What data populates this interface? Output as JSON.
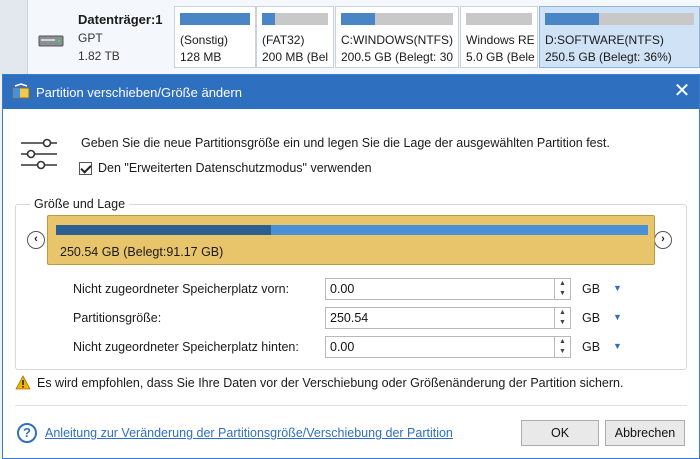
{
  "disk_map": {
    "disk_name": "Datenträger:1",
    "disk_type": "GPT",
    "disk_size": "1.82 TB",
    "partitions": [
      {
        "label": "(Sonstig)",
        "detail": "128 MB",
        "fill": 1.0
      },
      {
        "label": "(FAT32)",
        "detail": "200 MB (Bel",
        "fill": 0.2
      },
      {
        "label": "C:WINDOWS(NTFS)",
        "detail": "200.5 GB (Belegt: 30",
        "fill": 0.3
      },
      {
        "label": "Windows RE",
        "detail": "5.0 GB (Bele",
        "fill": 0.0
      },
      {
        "label": "D:SOFTWARE(NTFS)",
        "detail": "250.5 GB (Belegt: 36%)",
        "fill": 0.36,
        "selected": true
      }
    ]
  },
  "dialog": {
    "title": "Partition verschieben/Größe ändern",
    "close_label": "✕",
    "instruction": "Geben Sie die neue Partitionsgröße ein und legen Sie die Lage der ausgewählten Partition fest.",
    "checkbox_label": "Den \"Erweiterten Datenschutzmodus\" verwenden",
    "checkbox_checked": true,
    "group_title": "Größe und Lage",
    "partition_bar": {
      "label": "250.54 GB (Belegt:91.17 GB)",
      "used_fraction": 0.364
    },
    "nav_left": "‹",
    "nav_right": "›",
    "fields": [
      {
        "label": "Nicht zugeordneter Speicherplatz vorn:",
        "value": "0.00",
        "unit": "GB"
      },
      {
        "label": "Partitionsgröße:",
        "value": "250.54",
        "unit": "GB"
      },
      {
        "label": "Nicht zugeordneter Speicherplatz hinten:",
        "value": "0.00",
        "unit": "GB"
      }
    ],
    "warning": "Es wird empfohlen, dass Sie Ihre Daten vor der Verschiebung oder Größenänderung der Partition sichern.",
    "help_link": "Anleitung zur Veränderung der Partitionsgröße/Verschiebung der Partition",
    "ok_label": "OK",
    "cancel_label": "Abbrechen"
  },
  "colors": {
    "title_bar": "#2f6fbf",
    "partition_box": "#e8c56a",
    "bar_used": "#2e5f92",
    "bar_free": "#4a90d9"
  }
}
